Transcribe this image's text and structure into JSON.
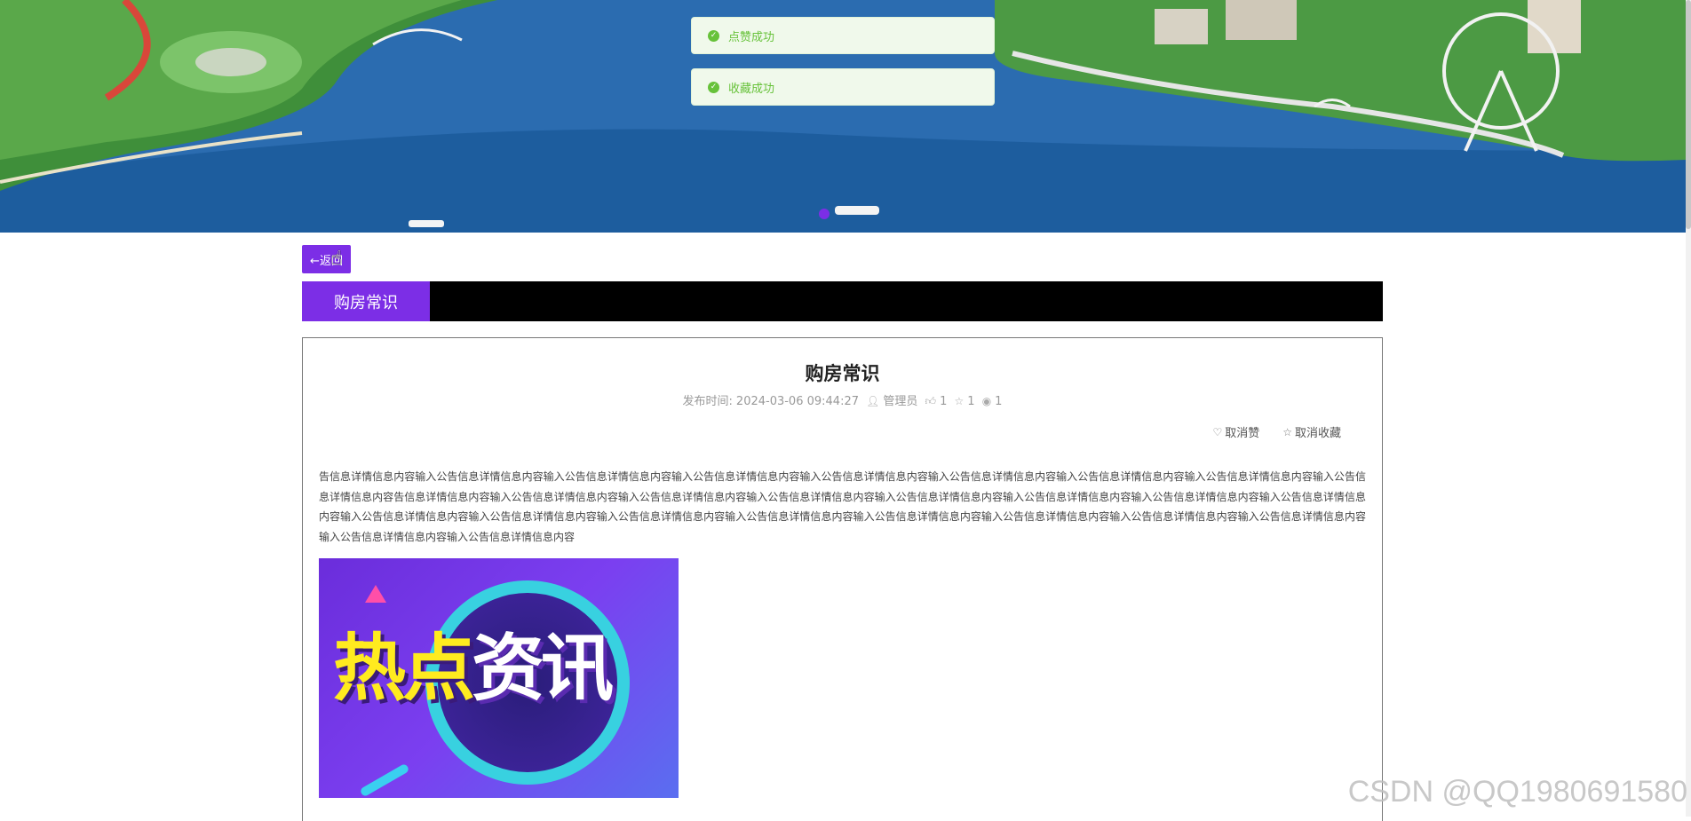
{
  "toasts": [
    {
      "text": "点赞成功"
    },
    {
      "text": "收藏成功"
    }
  ],
  "back_button": {
    "label": "←返回"
  },
  "section_tab": {
    "label": "购房常识"
  },
  "article": {
    "title": "购房常识",
    "publish_label": "发布时间:",
    "publish_time": "2024-03-06 09:44:27",
    "author": "管理员",
    "like_count": "1",
    "fav_count": "1",
    "view_count": "1",
    "unlike_label": "取消赞",
    "unfav_label": "取消收藏",
    "body": "告信息详情信息内容输入公告信息详情信息内容输入公告信息详情信息内容输入公告信息详情信息内容输入公告信息详情信息内容输入公告信息详情信息内容输入公告信息详情信息内容输入公告信息详情信息内容输入公告信息详情信息内容告信息详情信息内容输入公告信息详情信息内容输入公告信息详情信息内容输入公告信息详情信息内容输入公告信息详情信息内容输入公告信息详情信息内容输入公告信息详情信息内容输入公告信息详情信息内容输入公告信息详情信息内容输入公告信息详情信息内容输入公告信息详情信息内容输入公告信息详情信息内容输入公告信息详情信息内容输入公告信息详情信息内容输入公告信息详情信息内容输入公告信息详情信息内容输入公告信息详情信息内容输入公告信息详情信息内容",
    "image_text_yellow": "热点",
    "image_text_white": "资讯"
  },
  "watermark": "CSDN @QQ1980691580",
  "colors": {
    "accent": "#7c2ee6",
    "success": "#67c23a",
    "title_bar": "#000000"
  }
}
